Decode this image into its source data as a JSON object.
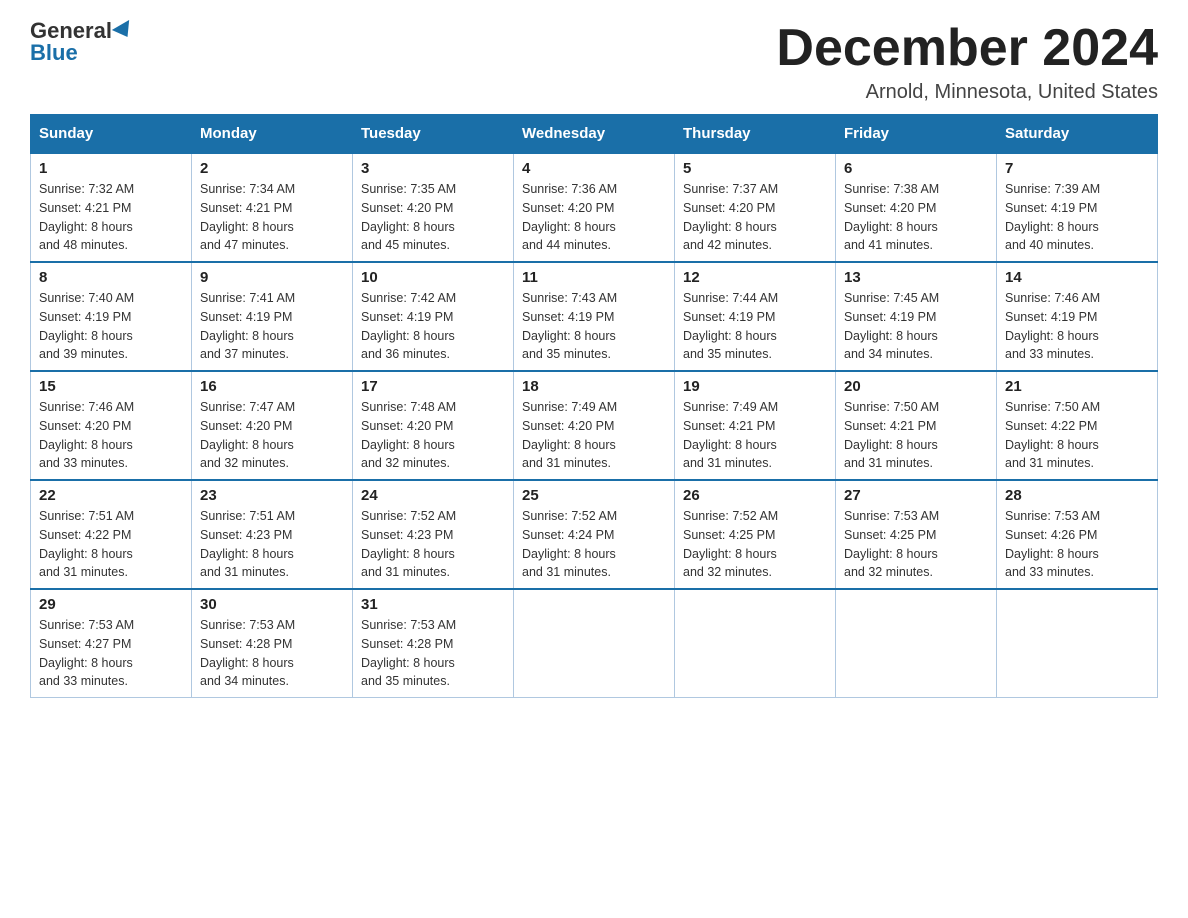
{
  "logo": {
    "general": "General",
    "blue": "Blue"
  },
  "title": "December 2024",
  "location": "Arnold, Minnesota, United States",
  "days_of_week": [
    "Sunday",
    "Monday",
    "Tuesday",
    "Wednesday",
    "Thursday",
    "Friday",
    "Saturday"
  ],
  "weeks": [
    [
      {
        "day": "1",
        "sunrise": "7:32 AM",
        "sunset": "4:21 PM",
        "daylight": "8 hours and 48 minutes."
      },
      {
        "day": "2",
        "sunrise": "7:34 AM",
        "sunset": "4:21 PM",
        "daylight": "8 hours and 47 minutes."
      },
      {
        "day": "3",
        "sunrise": "7:35 AM",
        "sunset": "4:20 PM",
        "daylight": "8 hours and 45 minutes."
      },
      {
        "day": "4",
        "sunrise": "7:36 AM",
        "sunset": "4:20 PM",
        "daylight": "8 hours and 44 minutes."
      },
      {
        "day": "5",
        "sunrise": "7:37 AM",
        "sunset": "4:20 PM",
        "daylight": "8 hours and 42 minutes."
      },
      {
        "day": "6",
        "sunrise": "7:38 AM",
        "sunset": "4:20 PM",
        "daylight": "8 hours and 41 minutes."
      },
      {
        "day": "7",
        "sunrise": "7:39 AM",
        "sunset": "4:19 PM",
        "daylight": "8 hours and 40 minutes."
      }
    ],
    [
      {
        "day": "8",
        "sunrise": "7:40 AM",
        "sunset": "4:19 PM",
        "daylight": "8 hours and 39 minutes."
      },
      {
        "day": "9",
        "sunrise": "7:41 AM",
        "sunset": "4:19 PM",
        "daylight": "8 hours and 37 minutes."
      },
      {
        "day": "10",
        "sunrise": "7:42 AM",
        "sunset": "4:19 PM",
        "daylight": "8 hours and 36 minutes."
      },
      {
        "day": "11",
        "sunrise": "7:43 AM",
        "sunset": "4:19 PM",
        "daylight": "8 hours and 35 minutes."
      },
      {
        "day": "12",
        "sunrise": "7:44 AM",
        "sunset": "4:19 PM",
        "daylight": "8 hours and 35 minutes."
      },
      {
        "day": "13",
        "sunrise": "7:45 AM",
        "sunset": "4:19 PM",
        "daylight": "8 hours and 34 minutes."
      },
      {
        "day": "14",
        "sunrise": "7:46 AM",
        "sunset": "4:19 PM",
        "daylight": "8 hours and 33 minutes."
      }
    ],
    [
      {
        "day": "15",
        "sunrise": "7:46 AM",
        "sunset": "4:20 PM",
        "daylight": "8 hours and 33 minutes."
      },
      {
        "day": "16",
        "sunrise": "7:47 AM",
        "sunset": "4:20 PM",
        "daylight": "8 hours and 32 minutes."
      },
      {
        "day": "17",
        "sunrise": "7:48 AM",
        "sunset": "4:20 PM",
        "daylight": "8 hours and 32 minutes."
      },
      {
        "day": "18",
        "sunrise": "7:49 AM",
        "sunset": "4:20 PM",
        "daylight": "8 hours and 31 minutes."
      },
      {
        "day": "19",
        "sunrise": "7:49 AM",
        "sunset": "4:21 PM",
        "daylight": "8 hours and 31 minutes."
      },
      {
        "day": "20",
        "sunrise": "7:50 AM",
        "sunset": "4:21 PM",
        "daylight": "8 hours and 31 minutes."
      },
      {
        "day": "21",
        "sunrise": "7:50 AM",
        "sunset": "4:22 PM",
        "daylight": "8 hours and 31 minutes."
      }
    ],
    [
      {
        "day": "22",
        "sunrise": "7:51 AM",
        "sunset": "4:22 PM",
        "daylight": "8 hours and 31 minutes."
      },
      {
        "day": "23",
        "sunrise": "7:51 AM",
        "sunset": "4:23 PM",
        "daylight": "8 hours and 31 minutes."
      },
      {
        "day": "24",
        "sunrise": "7:52 AM",
        "sunset": "4:23 PM",
        "daylight": "8 hours and 31 minutes."
      },
      {
        "day": "25",
        "sunrise": "7:52 AM",
        "sunset": "4:24 PM",
        "daylight": "8 hours and 31 minutes."
      },
      {
        "day": "26",
        "sunrise": "7:52 AM",
        "sunset": "4:25 PM",
        "daylight": "8 hours and 32 minutes."
      },
      {
        "day": "27",
        "sunrise": "7:53 AM",
        "sunset": "4:25 PM",
        "daylight": "8 hours and 32 minutes."
      },
      {
        "day": "28",
        "sunrise": "7:53 AM",
        "sunset": "4:26 PM",
        "daylight": "8 hours and 33 minutes."
      }
    ],
    [
      {
        "day": "29",
        "sunrise": "7:53 AM",
        "sunset": "4:27 PM",
        "daylight": "8 hours and 33 minutes."
      },
      {
        "day": "30",
        "sunrise": "7:53 AM",
        "sunset": "4:28 PM",
        "daylight": "8 hours and 34 minutes."
      },
      {
        "day": "31",
        "sunrise": "7:53 AM",
        "sunset": "4:28 PM",
        "daylight": "8 hours and 35 minutes."
      },
      null,
      null,
      null,
      null
    ]
  ],
  "labels": {
    "sunrise": "Sunrise:",
    "sunset": "Sunset:",
    "daylight": "Daylight:"
  }
}
